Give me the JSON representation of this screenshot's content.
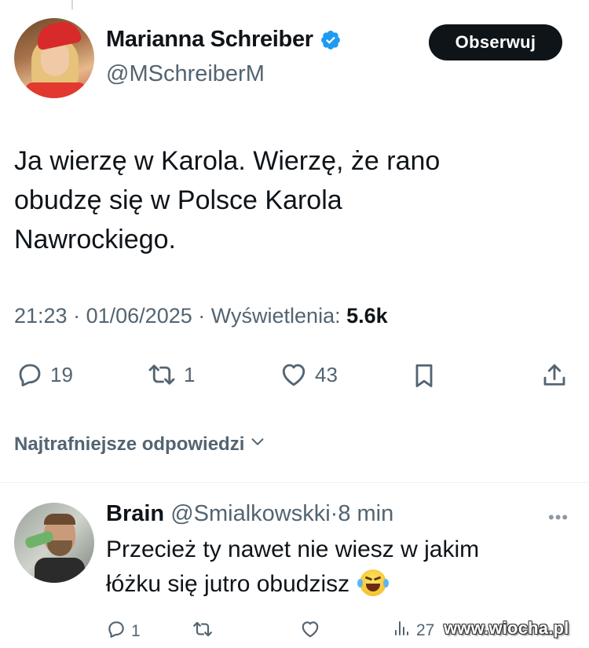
{
  "author": {
    "display_name": "Marianna Schreiber",
    "handle": "@MSchreiberM",
    "verified": true
  },
  "follow_button": {
    "label": "Obserwuj"
  },
  "tweet": {
    "text": "Ja wierzę w Karola. Wierzę, że rano\nobudzę się w Polsce Karola\nNawrockiego.",
    "time": "21:23",
    "date": "01/06/2025",
    "separator": "·",
    "views_label": "Wyświetlenia:",
    "views_count": "5.6k"
  },
  "actions": {
    "replies": "19",
    "reposts": "1",
    "likes": "43"
  },
  "replies_sort": {
    "label": "Najtrafniejsze odpowiedzi"
  },
  "reply": {
    "display_name": "Brain",
    "handle": "@Smialkowskki",
    "separator": "·",
    "time": "8 min",
    "more_label": "•••",
    "text": "Przecież ty nawet nie wiesz w jakim\nłóżku się jutro obudzisz",
    "emoji": "face-with-tears-of-joy",
    "replies": "1",
    "views": "27"
  },
  "watermark": {
    "text": "www.wiocha.pl"
  },
  "colors": {
    "text": "#0f1419",
    "secondary": "#536471",
    "verified_badge": "#1d9bf0",
    "follow_bg": "#0f1419"
  }
}
